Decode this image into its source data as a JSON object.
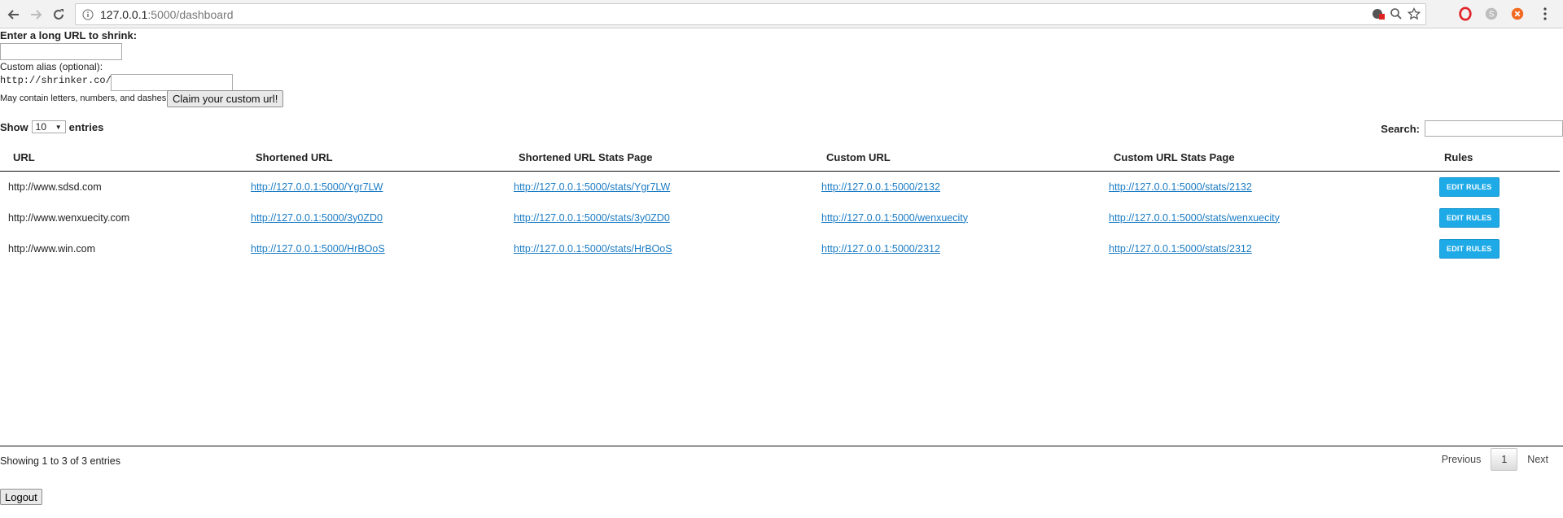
{
  "browser": {
    "url_host": "127.0.0.1",
    "url_path": ":5000/dashboard"
  },
  "form": {
    "shrink_label": "Enter a long URL to shrink:",
    "alias_label": "Custom alias (optional):",
    "alias_prefix": "http://shrinker.co/",
    "alias_hint": "May contain letters, numbers, and dashes.",
    "claim_button": "Claim your custom url!"
  },
  "table_controls": {
    "show_label": "Show",
    "page_length": "10",
    "entries_label": "entries",
    "search_label": "Search:"
  },
  "table": {
    "columns": [
      "URL",
      "Shortened URL",
      "Shortened URL Stats Page",
      "Custom URL",
      "Custom URL Stats Page",
      "Rules"
    ],
    "rows": [
      {
        "url": "http://www.sdsd.com",
        "short": "http://127.0.0.1:5000/Ygr7LW",
        "short_stats": "http://127.0.0.1:5000/stats/Ygr7LW",
        "custom": "http://127.0.0.1:5000/2132",
        "custom_stats": "http://127.0.0.1:5000/stats/2132",
        "rules": "EDIT RULES"
      },
      {
        "url": "http://www.wenxuecity.com",
        "short": "http://127.0.0.1:5000/3y0ZD0",
        "short_stats": "http://127.0.0.1:5000/stats/3y0ZD0",
        "custom": "http://127.0.0.1:5000/wenxuecity",
        "custom_stats": "http://127.0.0.1:5000/stats/wenxuecity",
        "rules": "EDIT RULES"
      },
      {
        "url": "http://www.win.com",
        "short": "http://127.0.0.1:5000/HrBOoS",
        "short_stats": "http://127.0.0.1:5000/stats/HrBOoS",
        "custom": "http://127.0.0.1:5000/2312",
        "custom_stats": "http://127.0.0.1:5000/stats/2312",
        "rules": "EDIT RULES"
      }
    ]
  },
  "footer": {
    "info": "Showing 1 to 3 of 3 entries",
    "previous": "Previous",
    "current_page": "1",
    "next": "Next",
    "logout": "Logout"
  },
  "colors": {
    "link": "#1a7bc4",
    "edit_button": "#1eaae7"
  }
}
